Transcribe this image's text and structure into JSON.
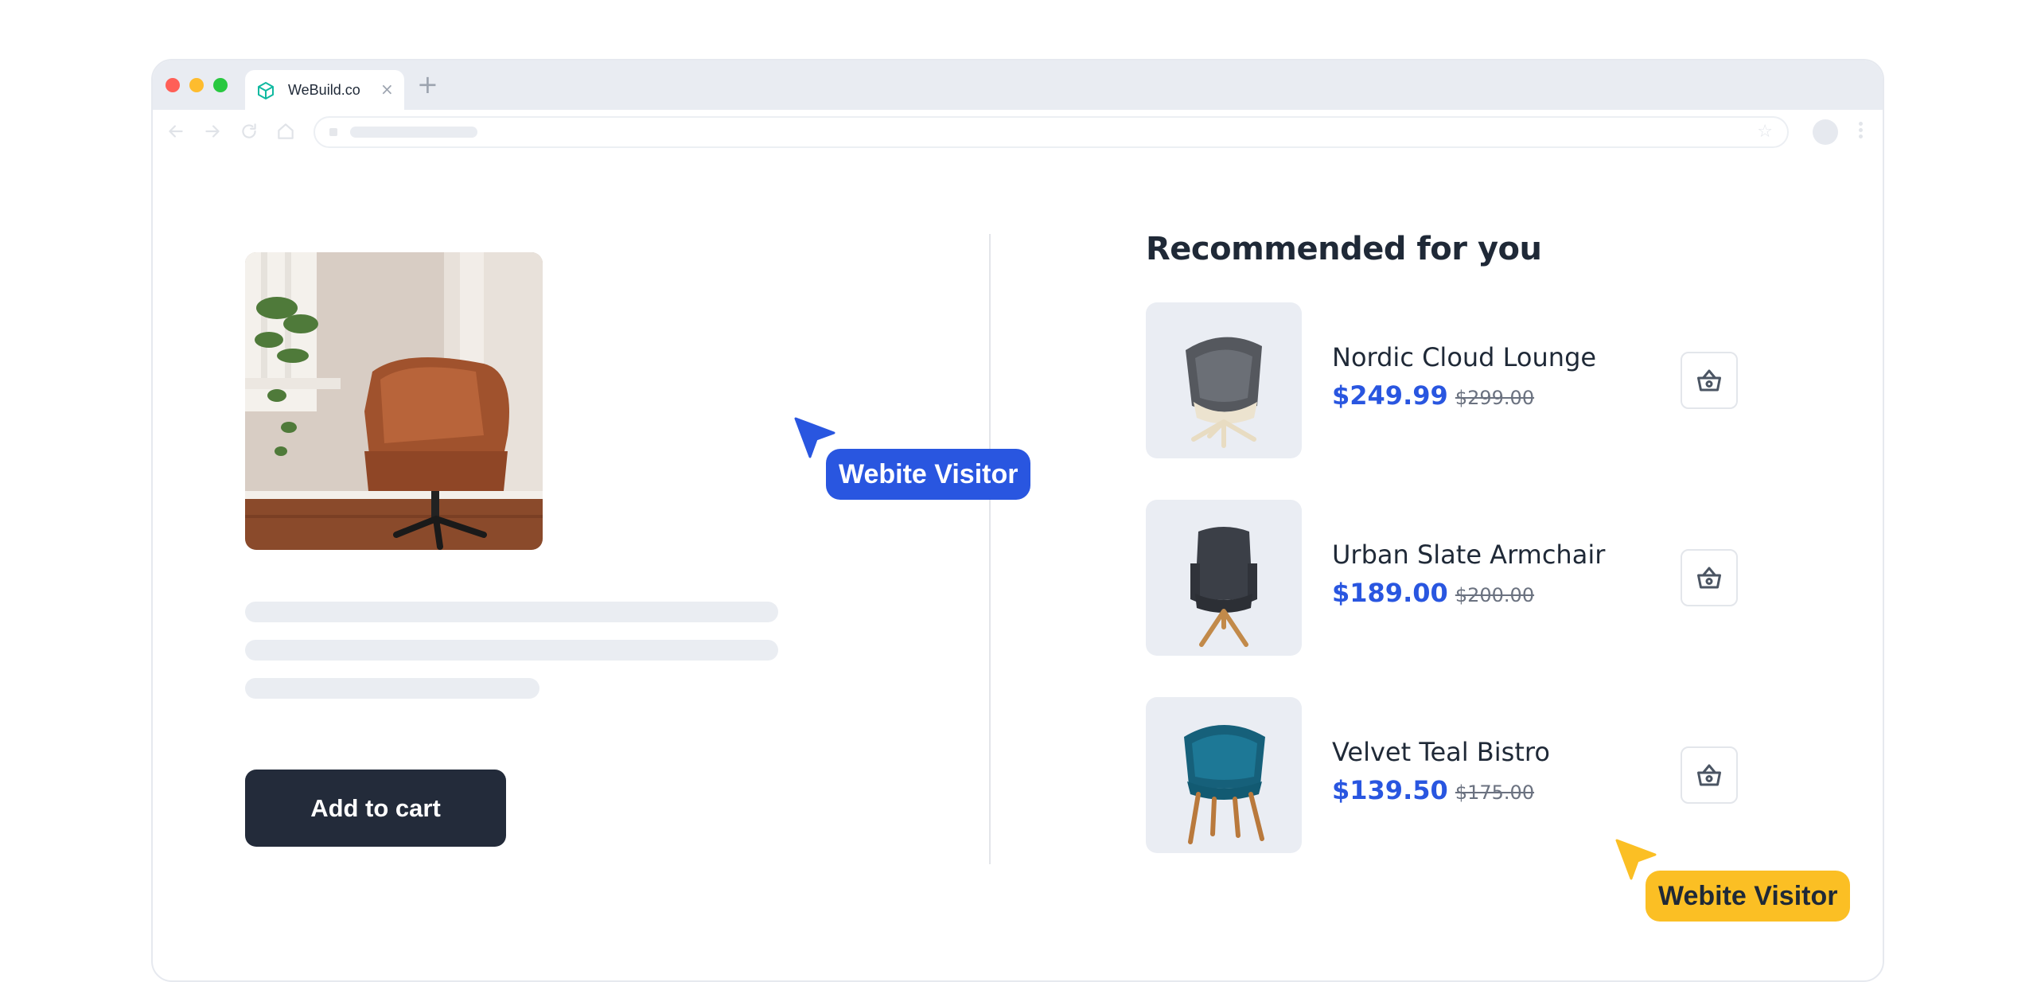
{
  "browser": {
    "tab_title": "WeBuild.co",
    "close_glyph": "×",
    "new_tab_glyph": "+",
    "icons": [
      "cube-logo-icon",
      "close-icon",
      "plus-icon",
      "back-arrow-icon",
      "forward-arrow-icon",
      "reload-icon",
      "home-icon",
      "lock-icon",
      "star-icon",
      "profile-avatar",
      "kebab-menu-icon"
    ]
  },
  "product": {
    "add_to_cart_label": "Add to cart"
  },
  "recommendations": {
    "heading": "Recommended for you",
    "items": [
      {
        "name": "Nordic Cloud Lounge",
        "price": "$249.99",
        "old_price": "$299.00"
      },
      {
        "name": "Urban Slate Armchair",
        "price": "$189.00",
        "old_price": "$200.00"
      },
      {
        "name": "Velvet Teal Bistro",
        "price": "$139.50",
        "old_price": "$175.00"
      }
    ]
  },
  "cursors": [
    {
      "label": "Webite Visitor",
      "color": "#2956e0",
      "text_color": "#ffffff"
    },
    {
      "label": "Webite Visitor",
      "color": "#fbbf24",
      "text_color": "#1f2937"
    }
  ],
  "colors": {
    "accent_blue": "#2956e0",
    "button_dark": "#232b3a",
    "tab_logo_green": "#10b9a0",
    "skeleton": "#eaedf2"
  }
}
